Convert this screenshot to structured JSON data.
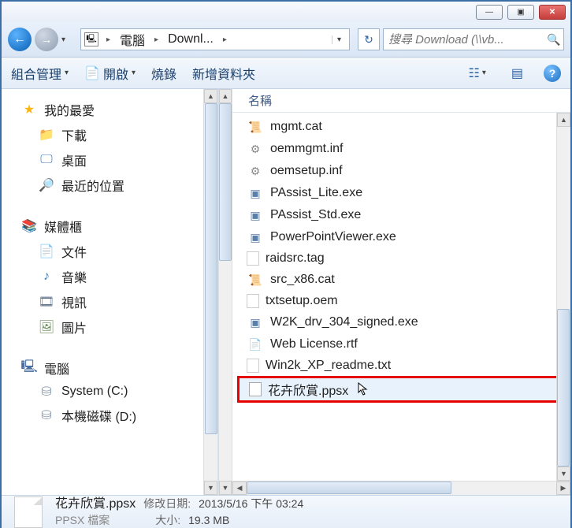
{
  "titlebar": {
    "min": "—",
    "max": "▣",
    "close": "✕"
  },
  "nav": {
    "back": "←",
    "fwd": "→",
    "dd": "▾",
    "addr_icon": "💻",
    "segments": [
      "電腦",
      "Downl..."
    ],
    "chev": "▸",
    "final_chev": "▸",
    "addr_dd": "▾",
    "refresh": "↻",
    "search_placeholder": "搜尋 Download (\\\\vb...",
    "search_icon": "🔍"
  },
  "toolbar": {
    "organize": "組合管理",
    "open": "開啟",
    "burn": "燒錄",
    "newfolder": "新增資料夾",
    "view_icon": "☷",
    "preview_icon": "▤",
    "help": "?"
  },
  "navpane": {
    "favorites": {
      "label": "我的最愛",
      "items": [
        "下載",
        "桌面",
        "最近的位置"
      ]
    },
    "libraries": {
      "label": "媒體櫃",
      "items": [
        "文件",
        "音樂",
        "視訊",
        "圖片"
      ]
    },
    "computer": {
      "label": "電腦",
      "items": [
        "System (C:)",
        "本機磁碟 (D:)"
      ]
    }
  },
  "filelist": {
    "header_name": "名稱",
    "items": [
      {
        "name": "mgmt.cat",
        "icon": "cat"
      },
      {
        "name": "oemmgmt.inf",
        "icon": "inf"
      },
      {
        "name": "oemsetup.inf",
        "icon": "inf"
      },
      {
        "name": "PAssist_Lite.exe",
        "icon": "exe"
      },
      {
        "name": "PAssist_Std.exe",
        "icon": "exe"
      },
      {
        "name": "PowerPointViewer.exe",
        "icon": "exe"
      },
      {
        "name": "raidsrc.tag",
        "icon": "txt"
      },
      {
        "name": "src_x86.cat",
        "icon": "cat"
      },
      {
        "name": "txtsetup.oem",
        "icon": "txt"
      },
      {
        "name": "W2K_drv_304_signed.exe",
        "icon": "exe"
      },
      {
        "name": "Web License.rtf",
        "icon": "rtf"
      },
      {
        "name": "Win2k_XP_readme.txt",
        "icon": "txt"
      },
      {
        "name": "花卉欣賞.ppsx",
        "icon": "ppsx",
        "selected": true
      }
    ]
  },
  "details": {
    "filename": "花卉欣賞.ppsx",
    "modified_label": "修改日期:",
    "modified_value": "2013/5/16 下午 03:24",
    "type": "PPSX 檔案",
    "size_label": "大小:",
    "size_value": "19.3 MB"
  }
}
